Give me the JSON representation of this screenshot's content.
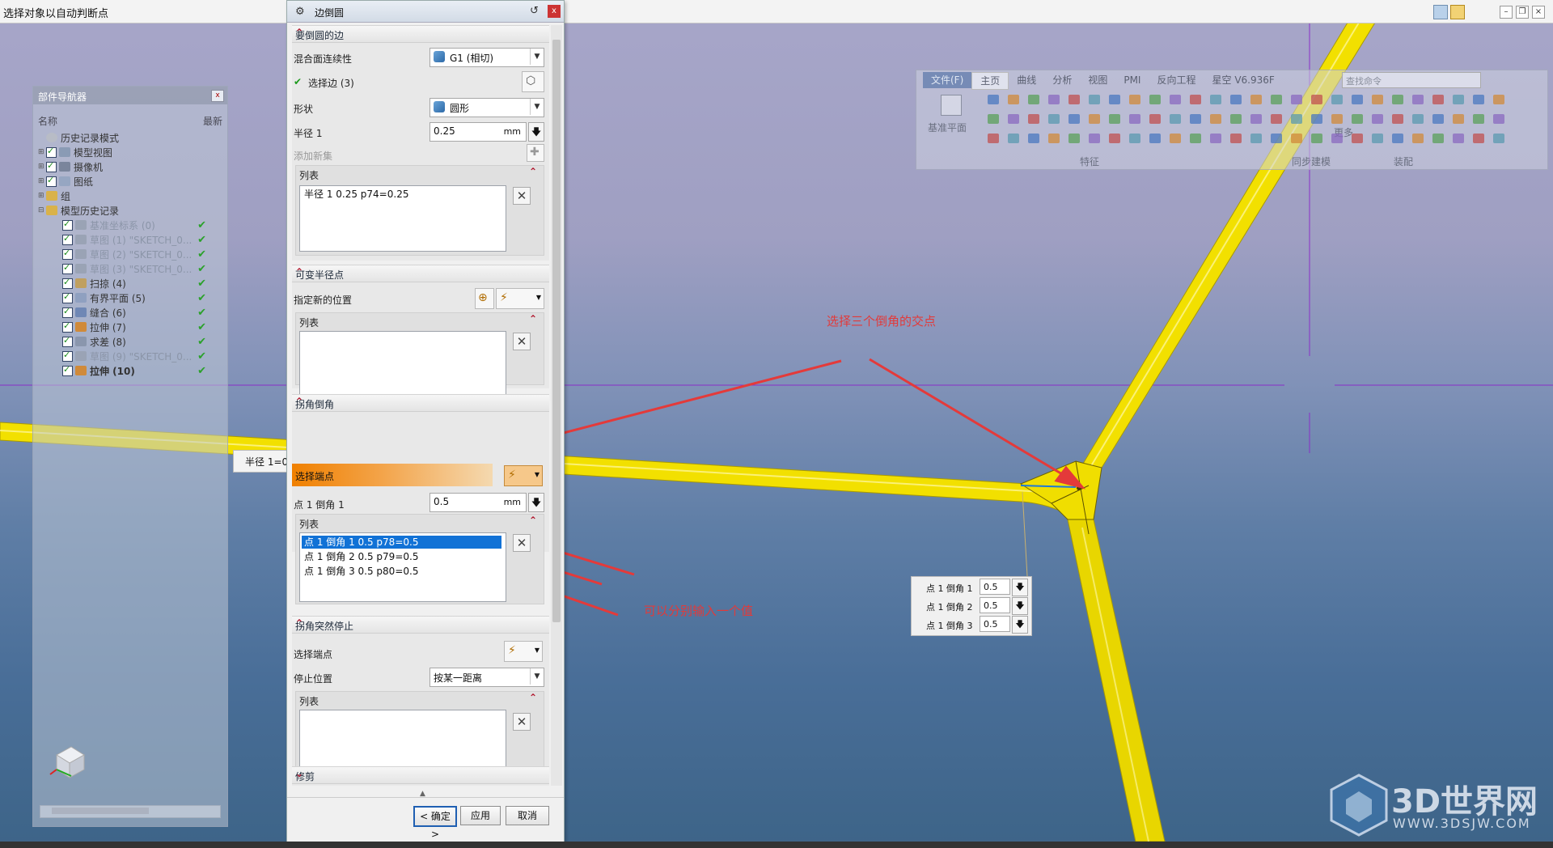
{
  "status": {
    "text": "选择对象以自动判断点"
  },
  "navigator": {
    "title": "部件导航器",
    "col_name": "名称",
    "col_latest": "最新",
    "items": [
      {
        "label": "历史记录模式",
        "faded": false
      },
      {
        "label": "模型视图",
        "faded": false
      },
      {
        "label": "摄像机",
        "faded": false
      },
      {
        "label": "图纸",
        "faded": false
      },
      {
        "label": "组",
        "faded": false
      },
      {
        "label": "模型历史记录",
        "faded": false
      },
      {
        "label": "基准坐标系 (0)",
        "faded": true
      },
      {
        "label": "草图 (1) \"SKETCH_0...",
        "faded": true
      },
      {
        "label": "草图 (2) \"SKETCH_0...",
        "faded": true
      },
      {
        "label": "草图 (3) \"SKETCH_0...",
        "faded": true
      },
      {
        "label": "扫掠 (4)",
        "faded": false
      },
      {
        "label": "有界平面 (5)",
        "faded": false
      },
      {
        "label": "缝合 (6)",
        "faded": false
      },
      {
        "label": "拉伸 (7)",
        "faded": false
      },
      {
        "label": "求差 (8)",
        "faded": false
      },
      {
        "label": "草图 (9) \"SKETCH_0...",
        "faded": true
      },
      {
        "label": "拉伸 (10)",
        "faded": false
      }
    ]
  },
  "dialog": {
    "title": "边倒圆",
    "sec_edge": "要倒圆的边",
    "blend_continuity_label": "混合面连续性",
    "blend_continuity_value": "G1 (相切)",
    "select_edge_label": "选择边 (3)",
    "shape_label": "形状",
    "shape_value": "圆形",
    "radius1_label": "半径 1",
    "radius1_value": "0.25",
    "unit": "mm",
    "add_new_set": "添加新集",
    "list_label": "列表",
    "edge_list_item": "半径 1  0.25  p74=0.25",
    "sec_var_radius": "可变半径点",
    "specify_new_location": "指定新的位置",
    "sec_corner_setback": "拐角倒角",
    "select_endpoint": "选择端点",
    "point_setback_label": "点 1 倒角 1",
    "point_setback_value": "0.5",
    "setback_items": [
      "点 1 倒角 1  0.5  p78=0.5",
      "点 1 倒角 2  0.5  p79=0.5",
      "点 1 倒角 3  0.5  p80=0.5"
    ],
    "sec_corner_stop": "拐角突然停止",
    "stop_location_label": "停止位置",
    "stop_location_value": "按某一距离",
    "sec_trim": "修剪",
    "ok": "< 确定 >",
    "apply": "应用",
    "cancel": "取消"
  },
  "ribbon": {
    "tabs": [
      "文件(F)",
      "主页",
      "曲线",
      "分析",
      "视图",
      "PMI",
      "反向工程",
      "星空 V6.936F"
    ],
    "search_placeholder": "查找命令",
    "datum_label": "基准平面",
    "more_label": "更多",
    "group_feature": "特征",
    "group_sync": "同步建模",
    "group_assembly": "装配"
  },
  "viewport": {
    "radius_chip": "半径 1=0",
    "annotation_select_intersection": "选择三个倒角的交点",
    "annotation_input_each": "可以分别输入一个值",
    "setback_rows": [
      {
        "label": "点 1 倒角 1",
        "value": "0.5"
      },
      {
        "label": "点 1 倒角 2",
        "value": "0.5"
      },
      {
        "label": "点 1 倒角 3",
        "value": "0.5"
      }
    ]
  },
  "watermark": {
    "brand": "3D世界网",
    "url": "WWW.3DSJW.COM"
  },
  "colors": {
    "tube": "#f2e000",
    "accent_orange": "#f08000",
    "arrow_red": "#e43a3a",
    "selection_blue": "#1172d6"
  }
}
